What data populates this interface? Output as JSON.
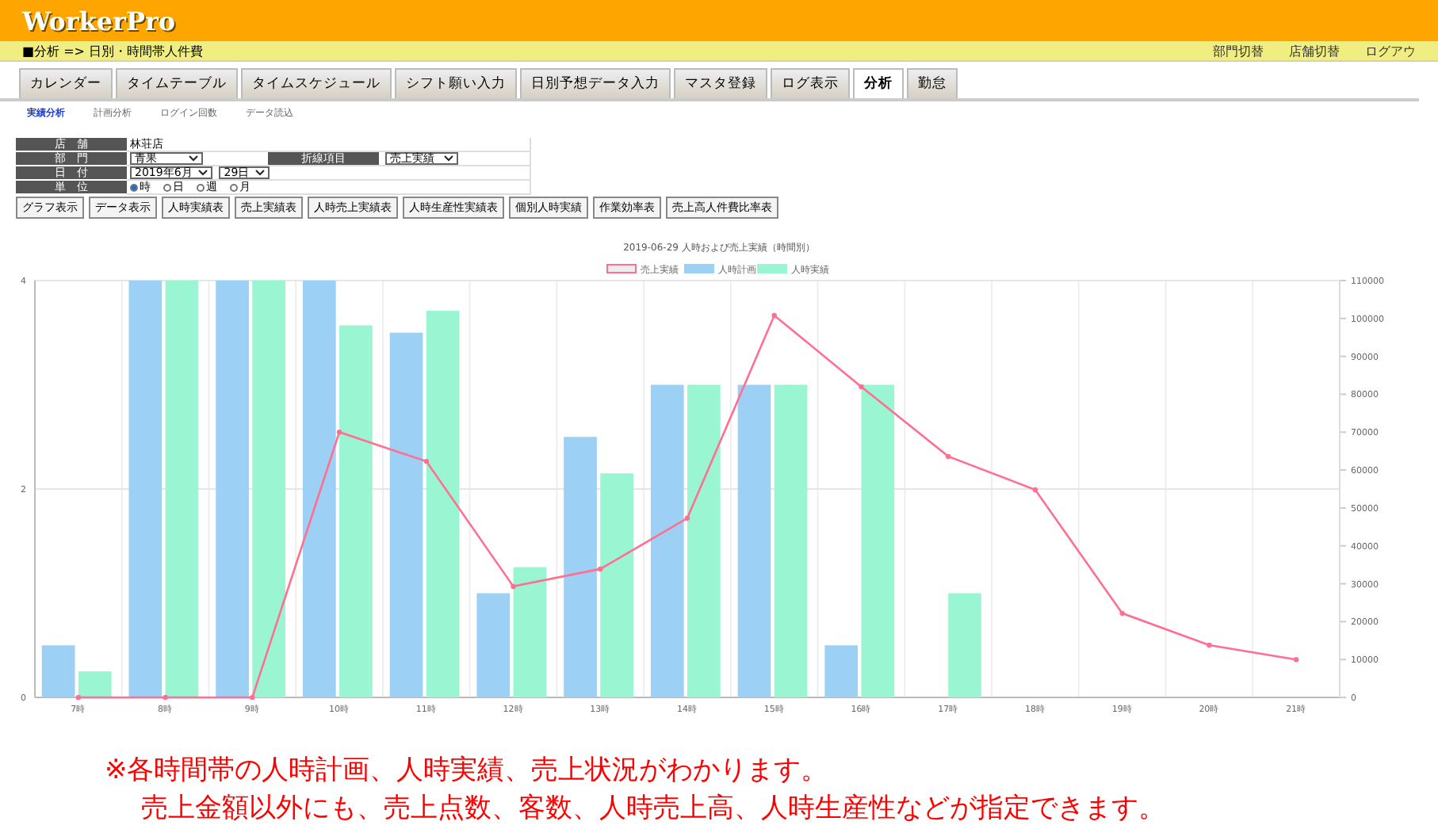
{
  "header": {
    "logo": "WorkerPro"
  },
  "breadcrumb": {
    "text": "■分析 => 日別・時間帯人件費",
    "links": [
      "部門切替",
      "店舗切替",
      "ログアウ"
    ]
  },
  "tabs": [
    {
      "label": "カレンダー",
      "selected": false
    },
    {
      "label": "タイムテーブル",
      "selected": false
    },
    {
      "label": "タイムスケジュール",
      "selected": false
    },
    {
      "label": "シフト願い入力",
      "selected": false
    },
    {
      "label": "日別予想データ入力",
      "selected": false
    },
    {
      "label": "マスタ登録",
      "selected": false
    },
    {
      "label": "ログ表示",
      "selected": false
    },
    {
      "label": "分析",
      "selected": true
    },
    {
      "label": "勤怠",
      "selected": false
    }
  ],
  "subtabs": [
    {
      "label": "実績分析",
      "selected": true
    },
    {
      "label": "計画分析",
      "selected": false
    },
    {
      "label": "ログイン回数",
      "selected": false
    },
    {
      "label": "データ読込",
      "selected": false
    }
  ],
  "form": {
    "store_label": "店　舗",
    "store": "林荘店",
    "dept_label": "部　門",
    "dept": "青果",
    "line_label": "折線項目",
    "line_item": "売上実績",
    "date_label": "日　付",
    "month": "2019年6月",
    "day": "29日",
    "unit_label": "単　位",
    "units": [
      {
        "label": "時",
        "selected": true
      },
      {
        "label": "日",
        "selected": false
      },
      {
        "label": "週",
        "selected": false
      },
      {
        "label": "月",
        "selected": false
      }
    ]
  },
  "buttons": [
    "グラフ表示",
    "データ表示",
    "人時実績表",
    "売上実績表",
    "人時売上実績表",
    "人時生産性実績表",
    "個別人時実績",
    "作業効率表",
    "売上高人件費比率表"
  ],
  "hours_chart": {
    "chart_data": {
      "type": "bar",
      "title": "2019-06-29 人時および売上実績（時間別）",
      "legend": true,
      "categories": [
        "7時",
        "8時",
        "9時",
        "10時",
        "11時",
        "12時",
        "13時",
        "14時",
        "15時",
        "16時",
        "17時",
        "18時",
        "19時",
        "20時",
        "21時"
      ],
      "series": [
        {
          "name": "人時計画",
          "color": "#9dd0f5",
          "values": [
            0.5,
            4,
            4,
            4,
            3.5,
            1,
            2.5,
            3,
            3,
            0.5,
            null,
            null,
            null,
            null,
            null
          ]
        },
        {
          "name": "人時実績",
          "color": "#9af5d3",
          "values": [
            0.25,
            4,
            4,
            3.57,
            3.71,
            1.25,
            2.15,
            3,
            3,
            3,
            1,
            null,
            null,
            null,
            null
          ]
        }
      ],
      "ylim": [
        0,
        4
      ],
      "yticks": [
        0,
        2,
        4
      ]
    }
  },
  "sales_chart": {
    "chart_data": {
      "type": "line",
      "legend": true,
      "series": [
        {
          "name": "売上実績",
          "color": "#ff6f91",
          "marker": "o",
          "values": [
            0,
            0,
            0,
            70000,
            62300,
            29300,
            33900,
            47300,
            100800,
            82000,
            63600,
            54800,
            22200,
            13800,
            10000
          ]
        }
      ],
      "ylim": [
        0,
        110000
      ],
      "yticks": [
        0,
        10000,
        20000,
        30000,
        40000,
        50000,
        60000,
        70000,
        80000,
        90000,
        100000,
        110000
      ]
    }
  },
  "notes": [
    "※各時間帯の人時計画、人時実績、売上状況がわかります。",
    "売上金額以外にも、売上点数、客数、人時売上高、人時生産性などが指定できます。"
  ]
}
